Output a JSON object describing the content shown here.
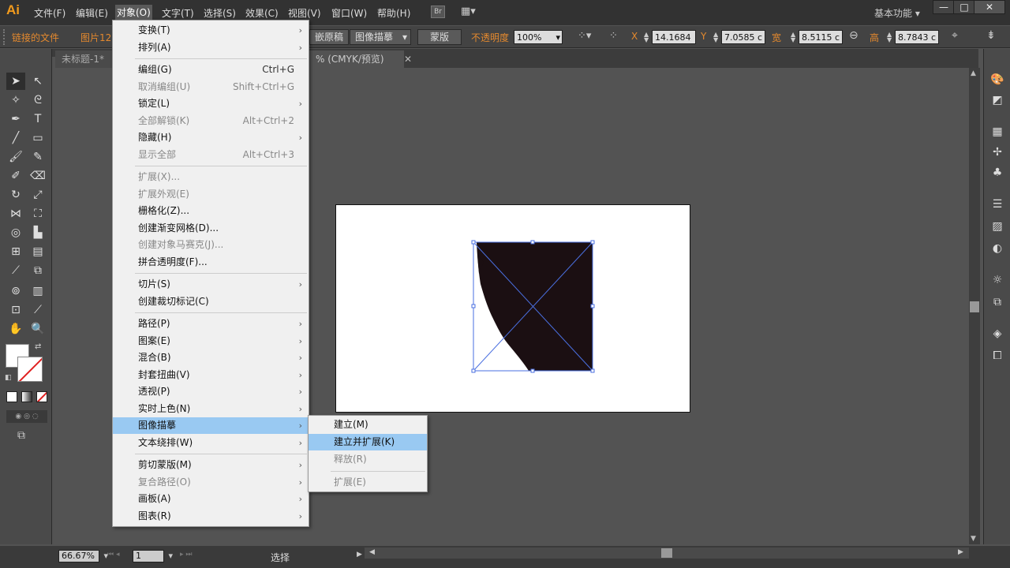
{
  "app": {
    "logo": "Ai"
  },
  "menubar": {
    "items": [
      "文件(F)",
      "编辑(E)",
      "对象(O)",
      "文字(T)",
      "选择(S)",
      "效果(C)",
      "视图(V)",
      "窗口(W)",
      "帮助(H)"
    ],
    "active": "对象(O)",
    "bridge_label": "Br",
    "workspace": "基本功能",
    "window_buttons": [
      "—",
      "□",
      "✕"
    ]
  },
  "controlbar": {
    "linked_file": "链接的文件",
    "image_name": "图片12.",
    "embed_btn": "嵌原稿",
    "trace_btn": "图像描摹",
    "mask_btn": "蒙版",
    "opacity_label": "不透明度",
    "opacity_value": "100%",
    "x_label": "X",
    "x_value": "14.1684",
    "y_label": "Y",
    "y_value": "7.0585 c",
    "w_label": "宽",
    "w_value": "8.5115 c",
    "h_label": "高",
    "h_value": "8.7843 c"
  },
  "tabs": {
    "doc1": "未标题-1*",
    "doc2_suffix": "% (CMYK/预览)"
  },
  "object_menu": {
    "items": [
      {
        "label": "变换(T)",
        "sub": true
      },
      {
        "label": "排列(A)",
        "sub": true
      },
      {
        "sep": true
      },
      {
        "label": "编组(G)",
        "shortcut": "Ctrl+G"
      },
      {
        "label": "取消编组(U)",
        "shortcut": "Shift+Ctrl+G",
        "disabled": true
      },
      {
        "label": "锁定(L)",
        "sub": true
      },
      {
        "label": "全部解锁(K)",
        "shortcut": "Alt+Ctrl+2",
        "disabled": true
      },
      {
        "label": "隐藏(H)",
        "sub": true
      },
      {
        "label": "显示全部",
        "shortcut": "Alt+Ctrl+3",
        "disabled": true
      },
      {
        "sep": true
      },
      {
        "label": "扩展(X)...",
        "disabled": true
      },
      {
        "label": "扩展外观(E)",
        "disabled": true
      },
      {
        "label": "栅格化(Z)..."
      },
      {
        "label": "创建渐变网格(D)..."
      },
      {
        "label": "创建对象马赛克(J)...",
        "disabled": true
      },
      {
        "label": "拼合透明度(F)..."
      },
      {
        "sep": true
      },
      {
        "label": "切片(S)",
        "sub": true
      },
      {
        "label": "创建裁切标记(C)"
      },
      {
        "sep": true
      },
      {
        "label": "路径(P)",
        "sub": true
      },
      {
        "label": "图案(E)",
        "sub": true
      },
      {
        "label": "混合(B)",
        "sub": true
      },
      {
        "label": "封套扭曲(V)",
        "sub": true
      },
      {
        "label": "透视(P)",
        "sub": true
      },
      {
        "label": "实时上色(N)",
        "sub": true
      },
      {
        "label": "图像描摹",
        "sub": true,
        "highlight": true
      },
      {
        "label": "文本绕排(W)",
        "sub": true
      },
      {
        "sep": true
      },
      {
        "label": "剪切蒙版(M)",
        "sub": true
      },
      {
        "label": "复合路径(O)",
        "sub": true,
        "disabled": true
      },
      {
        "label": "画板(A)",
        "sub": true
      },
      {
        "label": "图表(R)",
        "sub": true
      }
    ]
  },
  "trace_submenu": {
    "items": [
      {
        "label": "建立(M)"
      },
      {
        "label": "建立并扩展(K)",
        "highlight": true
      },
      {
        "label": "释放(R)",
        "disabled": true
      },
      {
        "sep": true
      },
      {
        "label": "扩展(E)",
        "disabled": true
      }
    ]
  },
  "statusbar": {
    "zoom": "66.67%",
    "artboard_num": "1",
    "tool_name": "选择"
  }
}
